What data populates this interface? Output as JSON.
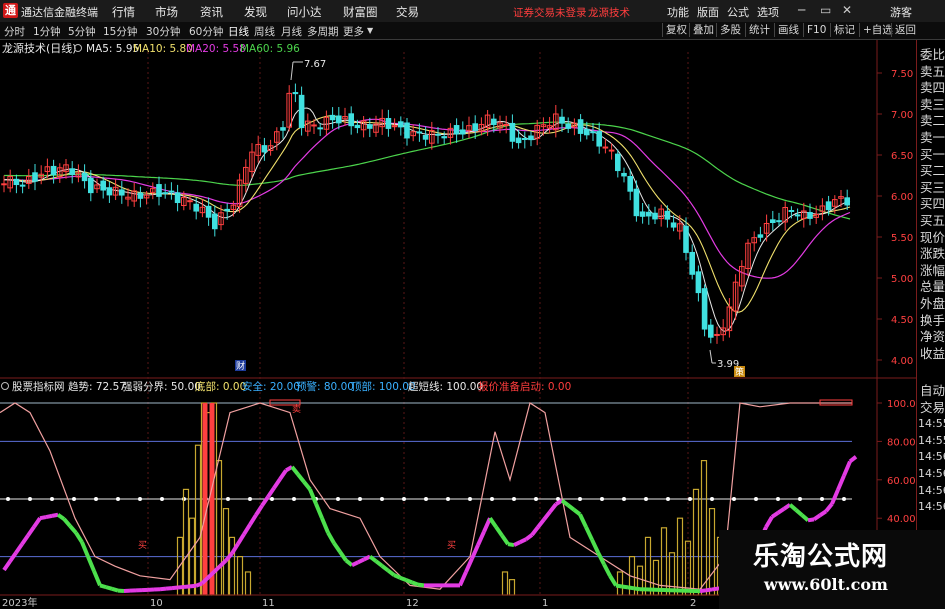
{
  "app": {
    "title": "通达信金融终端",
    "menu": [
      "行情",
      "市场",
      "资讯",
      "发现",
      "问小达",
      "财富圈",
      "交易"
    ],
    "warning": "证券交易未登录",
    "brand": "龙源技术",
    "right_menu": [
      "功能",
      "版面",
      "公式",
      "选项"
    ],
    "guest": "游客"
  },
  "toolbar": {
    "periods": [
      "分时",
      "1分钟",
      "5分钟",
      "15分钟",
      "30分钟",
      "60分钟",
      "日线",
      "周线",
      "月线",
      "多周期",
      "更多"
    ],
    "selected_period": "日线",
    "right_tools": [
      "复权",
      "叠加",
      "多股",
      "统计",
      "画线",
      "F10",
      "标记",
      "+自选",
      "返回"
    ]
  },
  "main_chart": {
    "stock_label": "龙源技术(日线)",
    "ma_labels": [
      {
        "text": "MA5: 5.95",
        "color": "#e8e8e8"
      },
      {
        "text": "MA10: 5.80",
        "color": "#f0e06c"
      },
      {
        "text": "MA20: 5.58",
        "color": "#e33be3"
      },
      {
        "text": "MA60: 5.96",
        "color": "#4cd44c"
      }
    ],
    "high_label": "7.67",
    "low_label": "3.99",
    "marker_cai": "财",
    "marker_ce": "策",
    "y_ticks": [
      "7.50",
      "7.00",
      "6.50",
      "6.00",
      "5.50",
      "5.00",
      "4.50",
      "4.00"
    ]
  },
  "indicator": {
    "name": "股票指标网",
    "labels": [
      {
        "text": "趋势: 72.57",
        "color": "#e8e8e8"
      },
      {
        "text": "强弱分界: 50.00",
        "color": "#e8e8e8"
      },
      {
        "text": "底部: 0.00",
        "color": "#f0e06c"
      },
      {
        "text": "安全: 20.00",
        "color": "#3ab0ff"
      },
      {
        "text": "预警: 80.00",
        "color": "#3ab0ff"
      },
      {
        "text": "顶部: 100.00",
        "color": "#3ab0ff"
      },
      {
        "text": "超短线: 100.00",
        "color": "#e8e8e8"
      },
      {
        "text": "报价准备启动: 0.00",
        "color": "#ff3d3d"
      }
    ],
    "mark_mai": "卖",
    "mark_b1": "买",
    "mark_b2": "买",
    "y_ticks": [
      "100.00",
      "80.00",
      "60.00",
      "40.00"
    ]
  },
  "x_axis": [
    "2023年",
    "10",
    "11",
    "12",
    "1",
    "2"
  ],
  "right_panel": {
    "top": [
      "委比",
      "卖五",
      "卖四",
      "卖三",
      "卖二",
      "卖一",
      "买一",
      "买二",
      "买三",
      "买四",
      "买五",
      "现价",
      "涨跌",
      "涨幅",
      "总量",
      "外盘",
      "换手",
      "净资",
      "收益"
    ],
    "bottom": [
      "自动",
      "交易",
      "14:55",
      "14:55",
      "14:56",
      "14:56",
      "14:56",
      "14:56"
    ]
  },
  "watermark": {
    "title": "乐淘公式网",
    "url": "www.60lt.com"
  },
  "colors": {
    "up": "#ff4040",
    "down": "#40e0e0",
    "ma5": "#e8e8e8",
    "ma10": "#f0e06c",
    "ma20": "#e33be3",
    "ma60": "#4cd44c",
    "frame": "#7a1c1c"
  }
}
